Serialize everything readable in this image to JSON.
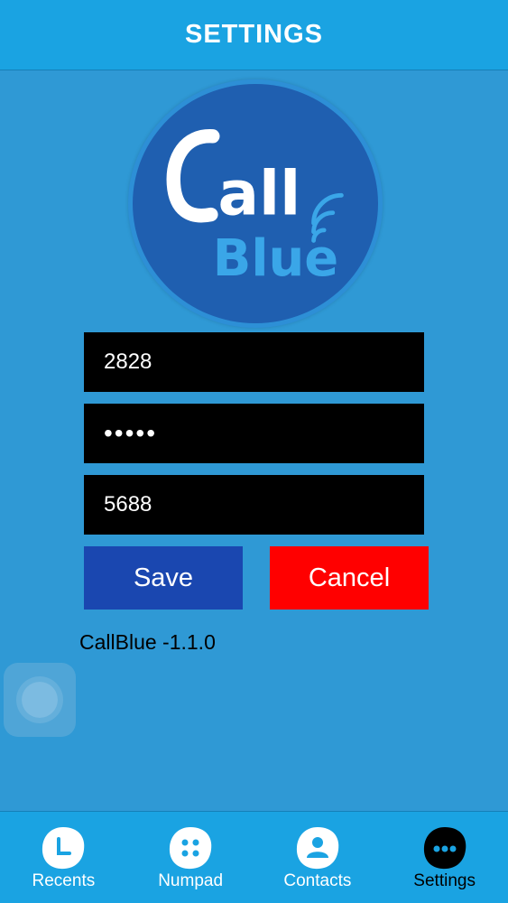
{
  "header": {
    "title": "SETTINGS"
  },
  "logo": {
    "line1": "Call",
    "line2": "Blue"
  },
  "form": {
    "username": "2828",
    "password_masked": "•••••",
    "extension": "5688"
  },
  "buttons": {
    "save": "Save",
    "cancel": "Cancel"
  },
  "version": "CallBlue -1.1.0",
  "tabs": [
    {
      "label": "Recents",
      "icon": "clock-icon",
      "active": false
    },
    {
      "label": "Numpad",
      "icon": "keypad-icon",
      "active": false
    },
    {
      "label": "Contacts",
      "icon": "person-icon",
      "active": false
    },
    {
      "label": "Settings",
      "icon": "more-icon",
      "active": true
    }
  ],
  "colors": {
    "background": "#2f99d5",
    "header": "#1aa3e2",
    "save": "#1a47b0",
    "cancel": "#ff0000",
    "field": "#000000"
  }
}
